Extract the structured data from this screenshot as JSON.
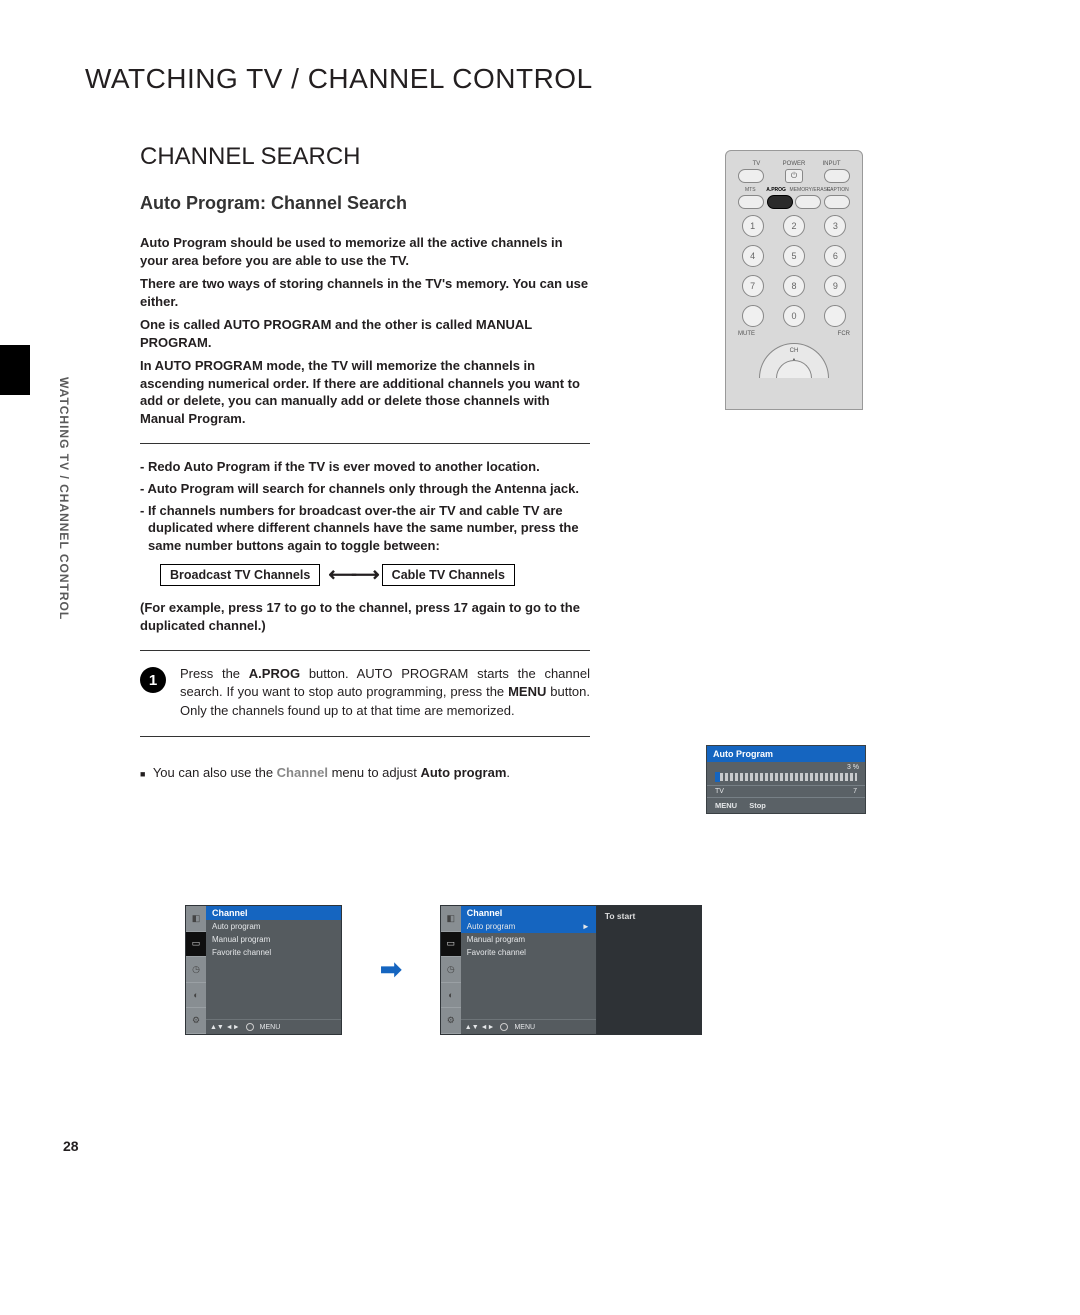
{
  "page_number": "28",
  "side_label": "WATCHING TV / CHANNEL CONTROL",
  "main_title": "WATCHING TV / CHANNEL CONTROL",
  "section_title": "CHANNEL SEARCH",
  "sub_title": "Auto Program: Channel Search",
  "intro": {
    "p1": "Auto Program should be used to memorize all the active channels in your area before you are able to use the TV.",
    "p2": "There are two ways of storing channels in the TV's memory. You can use either.",
    "p3": "One is called AUTO PROGRAM and the other is called MANUAL PROGRAM.",
    "p4": "In AUTO PROGRAM mode, the TV will memorize the channels in ascending numerical order. If there are additional channels you want to add or delete, you can manually add or delete those channels with Manual Program."
  },
  "notes": {
    "n1": "- Redo Auto Program if the TV is ever moved to another location.",
    "n2": "- Auto Program will search for channels only through the Antenna jack.",
    "n3": "- If channels numbers for broadcast over-the air TV and cable TV are duplicated where different channels have the same number, press the same number buttons again to toggle between:"
  },
  "toggle": {
    "left": "Broadcast TV Channels",
    "right": "Cable TV Channels"
  },
  "example": "(For example, press 17 to go to the channel, press 17 again to go to the duplicated channel.)",
  "step": {
    "num": "1",
    "text_before": "Press the ",
    "bold1": "A.PROG",
    "text_mid": " button. AUTO PROGRAM starts the channel search. If you want to stop auto programming, press the ",
    "bold2": "MENU",
    "text_after": " button. Only the channels found up to at that time are memorized."
  },
  "hint": {
    "bullet": "■",
    "pre": "You can also use the ",
    "grey": "Channel",
    "mid": " menu to adjust ",
    "bold": "Auto program",
    "post": "."
  },
  "remote": {
    "row1": {
      "l": "TV",
      "c": "POWER",
      "r": "INPUT"
    },
    "row2": {
      "l": "MTS",
      "c": "A.PROG",
      "r1": "MEMORY/ERASE",
      "r2": "CAPTION"
    },
    "nums": [
      "1",
      "2",
      "3",
      "4",
      "5",
      "6",
      "7",
      "8",
      "9",
      "",
      "0",
      ""
    ],
    "bottom": {
      "l": "MUTE",
      "r": "FCR"
    },
    "arc": "CH"
  },
  "osd_autoprog": {
    "title": "Auto Program",
    "pct": "3 %",
    "tv": "TV",
    "ch": "7",
    "menu": "MENU",
    "stop": "Stop"
  },
  "osd_menu": {
    "title": "Channel",
    "items": [
      "Auto program",
      "Manual program",
      "Favorite channel"
    ],
    "foot_nav": "▲▼  ◄►",
    "foot_menu": "MENU",
    "side_label": "To start",
    "arrow": "►"
  }
}
